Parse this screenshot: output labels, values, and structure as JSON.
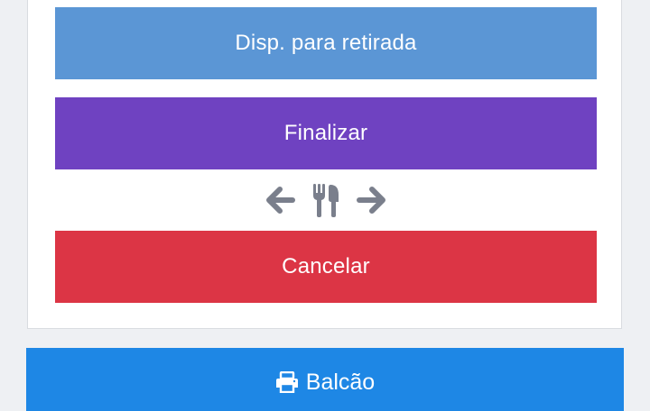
{
  "order_actions": {
    "ready_label": "Disp. para retirada",
    "finish_label": "Finalizar",
    "cancel_label": "Cancelar",
    "nav_icons": [
      "arrow-left-icon",
      "utensils-icon",
      "arrow-right-icon"
    ]
  },
  "counter": {
    "label": "Balcão",
    "icon": "printer-icon"
  },
  "colors": {
    "ready": "#5b96d5",
    "finish": "#6f42c1",
    "cancel": "#dc3545",
    "counter": "#1e87e5",
    "nav_icon": "#7a7f8c"
  }
}
